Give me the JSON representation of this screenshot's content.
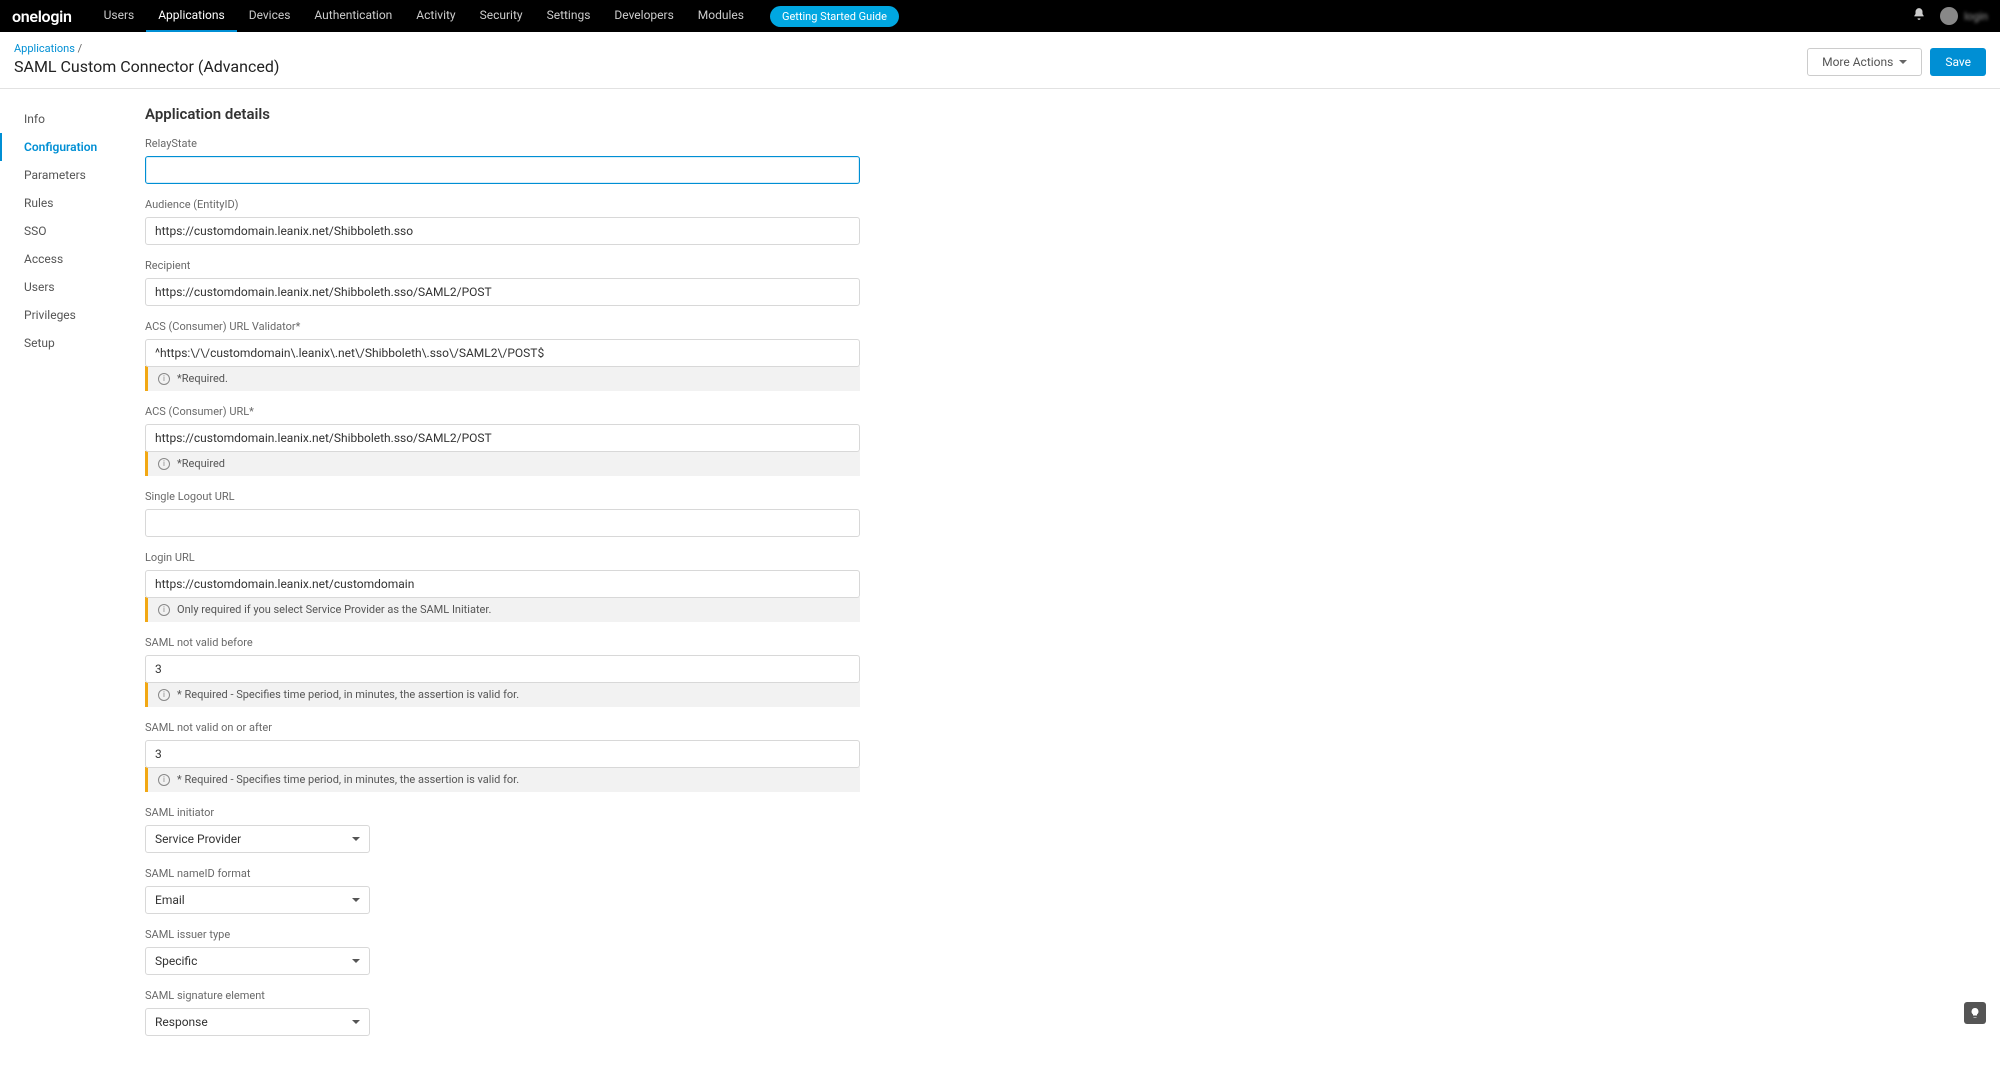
{
  "brand": "onelogin",
  "topnav": {
    "items": [
      "Users",
      "Applications",
      "Devices",
      "Authentication",
      "Activity",
      "Security",
      "Settings",
      "Developers",
      "Modules"
    ],
    "active_index": 1,
    "guide_label": "Getting Started Guide",
    "user_label": "login"
  },
  "breadcrumb": {
    "parent": "Applications",
    "sep": "/"
  },
  "page_title": "SAML Custom Connector (Advanced)",
  "actions": {
    "more": "More Actions",
    "save": "Save"
  },
  "sidebar": {
    "items": [
      "Info",
      "Configuration",
      "Parameters",
      "Rules",
      "SSO",
      "Access",
      "Users",
      "Privileges",
      "Setup"
    ],
    "active_index": 1
  },
  "section_title": "Application details",
  "fields": {
    "relaystate": {
      "label": "RelayState",
      "value": ""
    },
    "audience": {
      "label": "Audience (EntityID)",
      "value": "https://customdomain.leanix.net/Shibboleth.sso"
    },
    "recipient": {
      "label": "Recipient",
      "value": "https://customdomain.leanix.net/Shibboleth.sso/SAML2/POST"
    },
    "acs_validator": {
      "label": "ACS (Consumer) URL Validator*",
      "value": "^https:\\/\\/customdomain\\.leanix\\.net\\/Shibboleth\\.sso\\/SAML2\\/POST$",
      "hint": "*Required."
    },
    "acs_url": {
      "label": "ACS (Consumer) URL*",
      "value": "https://customdomain.leanix.net/Shibboleth.sso/SAML2/POST",
      "hint": "*Required"
    },
    "slo_url": {
      "label": "Single Logout URL",
      "value": ""
    },
    "login_url": {
      "label": "Login URL",
      "value": "https://customdomain.leanix.net/customdomain",
      "hint": "Only required if you select Service Provider as the SAML Initiater."
    },
    "not_before": {
      "label": "SAML not valid before",
      "value": "3",
      "hint": "* Required - Specifies time period, in minutes, the assertion is valid for."
    },
    "not_after": {
      "label": "SAML not valid on or after",
      "value": "3",
      "hint": "* Required - Specifies time period, in minutes, the assertion is valid for."
    },
    "initiator": {
      "label": "SAML initiator",
      "value": "Service Provider"
    },
    "nameid": {
      "label": "SAML nameID format",
      "value": "Email"
    },
    "issuer": {
      "label": "SAML issuer type",
      "value": "Specific"
    },
    "signature": {
      "label": "SAML signature element",
      "value": "Response"
    }
  }
}
